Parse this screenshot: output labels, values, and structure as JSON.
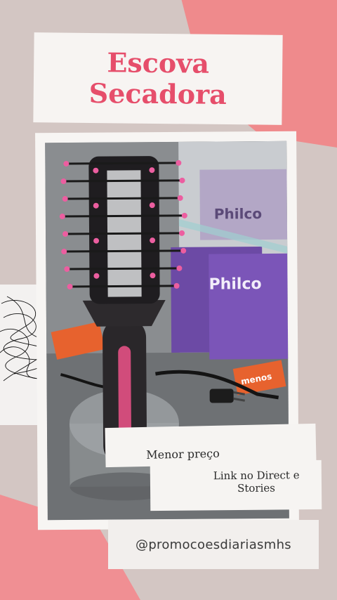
{
  "title": {
    "line1": "Escova",
    "line2": "Secadora"
  },
  "notes": {
    "price": "Menor preço",
    "link_line1": "Link no Direct e",
    "link_line2": "Stories"
  },
  "handle": "@promocoesdiariasmhs",
  "photo": {
    "box_brand": "Philco",
    "sign_text": "menos"
  },
  "colors": {
    "title": "#e64e6b",
    "accent_pink": "#ef8a8c",
    "background": "#d3c6c3",
    "card": "#f7f4f2"
  }
}
